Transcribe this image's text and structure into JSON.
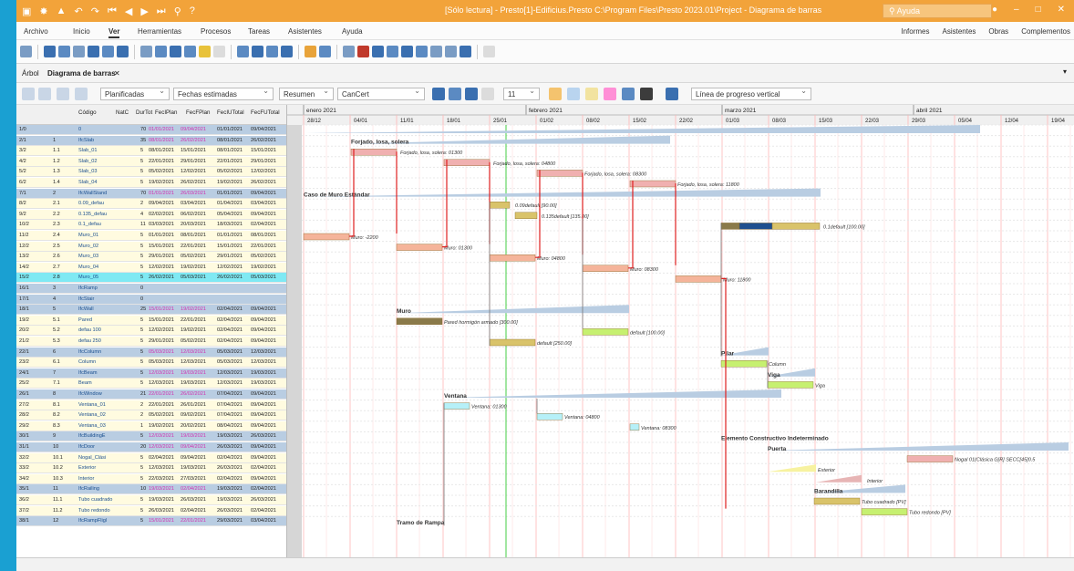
{
  "app": {
    "title": "[Sólo lectura] - Presto[1]-Edificius.Presto C:\\Program Files\\Presto 2023.01\\Project - Diagrama de barras",
    "help_placeholder": "Ayuda"
  },
  "menu": {
    "items": [
      "Archivo",
      "Inicio",
      "Ver",
      "Herramientas",
      "Procesos",
      "Tareas",
      "Asistentes",
      "Ayuda"
    ],
    "right": [
      "Informes",
      "Asistentes",
      "Obras",
      "Complementos"
    ]
  },
  "doc_tabs": [
    "Árbol",
    "Diagrama de barras"
  ],
  "toolbar": {
    "planificadas": "Planificadas",
    "fechas": "Fechas estimadas",
    "resumen": "Resumen",
    "cancert": "CanCert",
    "font_size": "11",
    "linea": "Línea de progreso vertical"
  },
  "grid": {
    "columns": [
      "Código",
      "NatC",
      "DurTot",
      "FecIPlan",
      "FecFPlan",
      "FecIUTotal",
      "FecFUTotal"
    ],
    "rows": [
      {
        "id": "1/0",
        "lvl": "",
        "code": "0",
        "dur": "70",
        "fi": "01/01/2021",
        "ff": "09/04/2021",
        "fiu": "01/01/2021",
        "ffu": "09/04/2021",
        "bg": "#b9cde2"
      },
      {
        "id": "2/1",
        "lvl": "1",
        "code": "IfcSlab",
        "dur": "35",
        "fi": "08/01/2021",
        "ff": "26/02/2021",
        "fiu": "08/01/2021",
        "ffu": "26/02/2021",
        "bg": "#b9cde2"
      },
      {
        "id": "3/2",
        "lvl": "1.1",
        "code": "Slab_01",
        "dur": "5",
        "fi": "08/01/2021",
        "ff": "15/01/2021",
        "fiu": "08/01/2021",
        "ffu": "15/01/2021",
        "bg": "#fffbe0"
      },
      {
        "id": "4/2",
        "lvl": "1.2",
        "code": "Slab_02",
        "dur": "5",
        "fi": "22/01/2021",
        "ff": "29/01/2021",
        "fiu": "22/01/2021",
        "ffu": "29/01/2021",
        "bg": "#fffbe0"
      },
      {
        "id": "5/2",
        "lvl": "1.3",
        "code": "Slab_03",
        "dur": "5",
        "fi": "05/02/2021",
        "ff": "12/02/2021",
        "fiu": "05/02/2021",
        "ffu": "12/02/2021",
        "bg": "#fffbe0"
      },
      {
        "id": "6/2",
        "lvl": "1.4",
        "code": "Slab_04",
        "dur": "5",
        "fi": "19/02/2021",
        "ff": "26/02/2021",
        "fiu": "19/02/2021",
        "ffu": "26/02/2021",
        "bg": "#fffbe0"
      },
      {
        "id": "7/1",
        "lvl": "2",
        "code": "IfcWallStand",
        "dur": "70",
        "fi": "01/01/2021",
        "ff": "26/03/2021",
        "fiu": "01/01/2021",
        "ffu": "09/04/2021",
        "bg": "#b9cde2"
      },
      {
        "id": "8/2",
        "lvl": "2.1",
        "code": "0.09_defau",
        "dur": "2",
        "fi": "09/04/2021",
        "ff": "03/04/2021",
        "fiu": "01/04/2021",
        "ffu": "03/04/2021",
        "bg": "#fffbe0"
      },
      {
        "id": "9/2",
        "lvl": "2.2",
        "code": "0.135_defau",
        "dur": "4",
        "fi": "02/02/2021",
        "ff": "06/02/2021",
        "fiu": "05/04/2021",
        "ffu": "09/04/2021",
        "bg": "#fffbe0"
      },
      {
        "id": "10/2",
        "lvl": "2.3",
        "code": "0.1_defau",
        "dur": "11",
        "fi": "03/03/2021",
        "ff": "20/03/2021",
        "fiu": "18/03/2021",
        "ffu": "02/04/2021",
        "bg": "#fffbe0"
      },
      {
        "id": "11/2",
        "lvl": "2.4",
        "code": "Muro_01",
        "dur": "5",
        "fi": "01/01/2021",
        "ff": "08/01/2021",
        "fiu": "01/01/2021",
        "ffu": "08/01/2021",
        "bg": "#fffbe0"
      },
      {
        "id": "12/2",
        "lvl": "2.5",
        "code": "Muro_02",
        "dur": "5",
        "fi": "15/01/2021",
        "ff": "22/01/2021",
        "fiu": "15/01/2021",
        "ffu": "22/01/2021",
        "bg": "#fffbe0"
      },
      {
        "id": "13/2",
        "lvl": "2.6",
        "code": "Muro_03",
        "dur": "5",
        "fi": "29/01/2021",
        "ff": "05/02/2021",
        "fiu": "29/01/2021",
        "ffu": "05/02/2021",
        "bg": "#fffbe0"
      },
      {
        "id": "14/2",
        "lvl": "2.7",
        "code": "Muro_04",
        "dur": "5",
        "fi": "12/02/2021",
        "ff": "19/02/2021",
        "fiu": "12/02/2021",
        "ffu": "19/02/2021",
        "bg": "#fffbe0"
      },
      {
        "id": "15/2",
        "lvl": "2.8",
        "code": "Muro_05",
        "dur": "5",
        "fi": "26/02/2021",
        "ff": "05/03/2021",
        "fiu": "26/02/2021",
        "ffu": "05/03/2021",
        "bg": "#7fe9f3"
      },
      {
        "id": "16/1",
        "lvl": "3",
        "code": "IfcRamp",
        "dur": "0",
        "fi": "",
        "ff": "",
        "fiu": "",
        "ffu": "",
        "bg": "#b9cde2"
      },
      {
        "id": "17/1",
        "lvl": "4",
        "code": "IfcStair",
        "dur": "0",
        "fi": "",
        "ff": "",
        "fiu": "",
        "ffu": "",
        "bg": "#b9cde2"
      },
      {
        "id": "18/1",
        "lvl": "5",
        "code": "IfcWall",
        "dur": "25",
        "fi": "15/01/2021",
        "ff": "19/02/2021",
        "fiu": "02/04/2021",
        "ffu": "09/04/2021",
        "bg": "#b9cde2"
      },
      {
        "id": "19/2",
        "lvl": "5.1",
        "code": "Pared",
        "dur": "5",
        "fi": "15/01/2021",
        "ff": "22/01/2021",
        "fiu": "02/04/2021",
        "ffu": "09/04/2021",
        "bg": "#fffbe0"
      },
      {
        "id": "20/2",
        "lvl": "5.2",
        "code": "defau 100",
        "dur": "5",
        "fi": "12/02/2021",
        "ff": "19/02/2021",
        "fiu": "02/04/2021",
        "ffu": "09/04/2021",
        "bg": "#fffbe0"
      },
      {
        "id": "21/2",
        "lvl": "5.3",
        "code": "defau 250",
        "dur": "5",
        "fi": "29/01/2021",
        "ff": "05/02/2021",
        "fiu": "02/04/2021",
        "ffu": "09/04/2021",
        "bg": "#fffbe0"
      },
      {
        "id": "22/1",
        "lvl": "6",
        "code": "IfcColumn",
        "dur": "5",
        "fi": "05/03/2021",
        "ff": "12/03/2021",
        "fiu": "05/03/2021",
        "ffu": "12/03/2021",
        "bg": "#b9cde2"
      },
      {
        "id": "23/2",
        "lvl": "6.1",
        "code": "Column",
        "dur": "5",
        "fi": "05/03/2021",
        "ff": "12/03/2021",
        "fiu": "05/03/2021",
        "ffu": "12/03/2021",
        "bg": "#fffbe0"
      },
      {
        "id": "24/1",
        "lvl": "7",
        "code": "IfcBeam",
        "dur": "5",
        "fi": "12/03/2021",
        "ff": "19/03/2021",
        "fiu": "12/03/2021",
        "ffu": "19/03/2021",
        "bg": "#b9cde2"
      },
      {
        "id": "25/2",
        "lvl": "7.1",
        "code": "Beam",
        "dur": "5",
        "fi": "12/03/2021",
        "ff": "19/03/2021",
        "fiu": "12/03/2021",
        "ffu": "19/03/2021",
        "bg": "#fffbe0"
      },
      {
        "id": "26/1",
        "lvl": "8",
        "code": "IfcWindow",
        "dur": "21",
        "fi": "22/01/2021",
        "ff": "26/02/2021",
        "fiu": "07/04/2021",
        "ffu": "09/04/2021",
        "bg": "#b9cde2"
      },
      {
        "id": "27/2",
        "lvl": "8.1",
        "code": "Ventana_01",
        "dur": "2",
        "fi": "22/01/2021",
        "ff": "26/01/2021",
        "fiu": "07/04/2021",
        "ffu": "09/04/2021",
        "bg": "#fffbe0"
      },
      {
        "id": "28/2",
        "lvl": "8.2",
        "code": "Ventana_02",
        "dur": "2",
        "fi": "05/02/2021",
        "ff": "09/02/2021",
        "fiu": "07/04/2021",
        "ffu": "09/04/2021",
        "bg": "#fffbe0"
      },
      {
        "id": "29/2",
        "lvl": "8.3",
        "code": "Ventana_03",
        "dur": "1",
        "fi": "19/02/2021",
        "ff": "20/02/2021",
        "fiu": "08/04/2021",
        "ffu": "09/04/2021",
        "bg": "#fffbe0"
      },
      {
        "id": "30/1",
        "lvl": "9",
        "code": "IfcBuildingE",
        "dur": "5",
        "fi": "12/03/2021",
        "ff": "19/03/2021",
        "fiu": "19/03/2021",
        "ffu": "26/03/2021",
        "bg": "#b9cde2"
      },
      {
        "id": "31/1",
        "lvl": "10",
        "code": "IfcDoor",
        "dur": "20",
        "fi": "12/03/2021",
        "ff": "09/04/2021",
        "fiu": "26/03/2021",
        "ffu": "09/04/2021",
        "bg": "#b9cde2"
      },
      {
        "id": "32/2",
        "lvl": "10.1",
        "code": "Nogal_Clási",
        "dur": "5",
        "fi": "02/04/2021",
        "ff": "09/04/2021",
        "fiu": "02/04/2021",
        "ffu": "09/04/2021",
        "bg": "#fffbe0"
      },
      {
        "id": "33/2",
        "lvl": "10.2",
        "code": "Exterior",
        "dur": "5",
        "fi": "12/03/2021",
        "ff": "19/03/2021",
        "fiu": "26/03/2021",
        "ffu": "02/04/2021",
        "bg": "#fffbe0"
      },
      {
        "id": "34/2",
        "lvl": "10.3",
        "code": "Interior",
        "dur": "5",
        "fi": "22/03/2021",
        "ff": "27/03/2021",
        "fiu": "02/04/2021",
        "ffu": "09/04/2021",
        "bg": "#fffbe0"
      },
      {
        "id": "35/1",
        "lvl": "11",
        "code": "IfcRailing",
        "dur": "10",
        "fi": "19/03/2021",
        "ff": "02/04/2021",
        "fiu": "19/03/2021",
        "ffu": "02/04/2021",
        "bg": "#b9cde2"
      },
      {
        "id": "36/2",
        "lvl": "11.1",
        "code": "Tubo cuadrado",
        "dur": "5",
        "fi": "19/03/2021",
        "ff": "26/03/2021",
        "fiu": "19/03/2021",
        "ffu": "26/03/2021",
        "bg": "#fffbe0"
      },
      {
        "id": "37/2",
        "lvl": "11.2",
        "code": "Tubo redondo",
        "dur": "5",
        "fi": "26/03/2021",
        "ff": "02/04/2021",
        "fiu": "26/03/2021",
        "ffu": "02/04/2021",
        "bg": "#fffbe0"
      },
      {
        "id": "38/1",
        "lvl": "12",
        "code": "IfcRampFligl",
        "dur": "5",
        "fi": "15/01/2021",
        "ff": "22/01/2021",
        "fiu": "29/03/2021",
        "ffu": "03/04/2021",
        "bg": "#b9cde2"
      }
    ]
  },
  "timeline": {
    "months": [
      "enero 2021",
      "febrero 2021",
      "marzo 2021",
      "abril 2021"
    ],
    "weeks": [
      "28/12",
      "04/01",
      "11/01",
      "18/01",
      "25/01",
      "01/02",
      "08/02",
      "15/02",
      "22/02",
      "01/03",
      "08/03",
      "15/03",
      "22/03",
      "29/03",
      "05/04",
      "12/04",
      "19/04"
    ]
  },
  "gantt_labels": [
    "Forjado, losa, solera",
    "Forjado, losa, solera: 01300",
    "Forjado, losa, solera: 04800",
    "Forjado, losa, solera: 08300",
    "Forjado, losa, solera: 11800",
    "Caso de Muro Estándar",
    "0.09default [90.00]",
    "0.135default [135.00]",
    "0.1default [100.00]",
    "Muro: -2200",
    "Muro: 01300",
    "Muro: 04800",
    "Muro: 08300",
    "Muro: 11800",
    "Muro",
    "Pared hormigón armado [300.00]",
    "default [100.00]",
    "default [250.00]",
    "Pilar",
    "Column",
    "Viga",
    "Viga",
    "Ventana",
    "Ventana: 01300",
    "Ventana: 04800",
    "Ventana: 08300",
    "Elemento Constructivo Indeterminado",
    "Puerta",
    "Nogal 01(Clásica G[R] SECC[45]0.5",
    "Exterior",
    "Interior",
    "Barandilla",
    "Tubo cuadrado [PV]",
    "Tubo redondo [PV]",
    "Tramo de Rampa"
  ]
}
